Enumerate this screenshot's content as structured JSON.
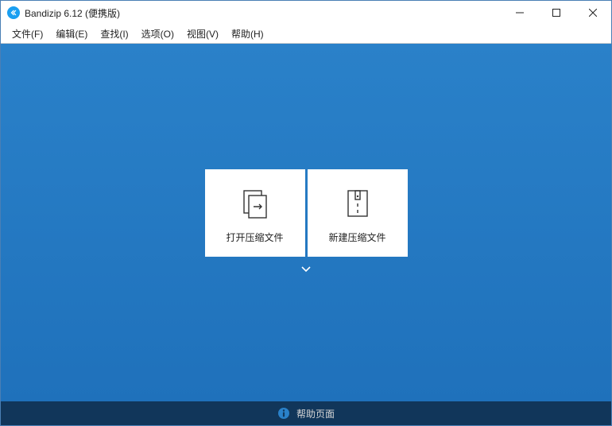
{
  "titlebar": {
    "title": "Bandizip 6.12 (便携版)"
  },
  "menu": {
    "file": "文件(F)",
    "edit": "编辑(E)",
    "find": "查找(I)",
    "options": "选项(O)",
    "view": "视图(V)",
    "help": "帮助(H)"
  },
  "tiles": {
    "open": "打开压缩文件",
    "new": "新建压缩文件"
  },
  "statusbar": {
    "help": "帮助页面"
  }
}
